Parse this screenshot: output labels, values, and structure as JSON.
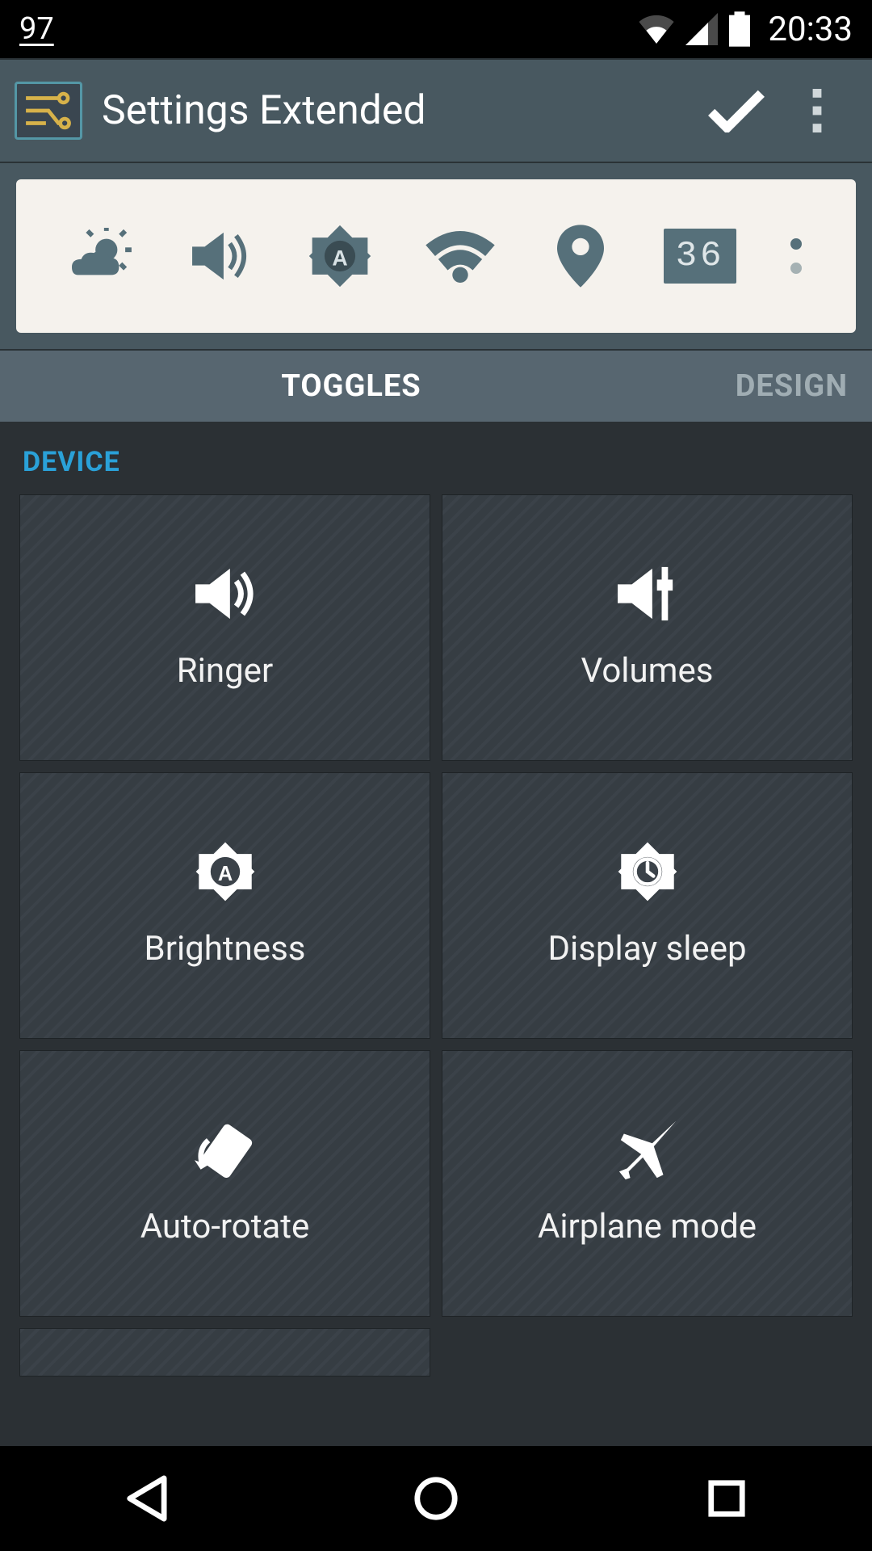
{
  "status": {
    "left": "97",
    "time": "20:33"
  },
  "appbar": {
    "title": "Settings Extended"
  },
  "preview": {
    "digit": "36"
  },
  "tabs": {
    "active": "TOGGLES",
    "inactive": "DESIGN"
  },
  "section": {
    "title": "DEVICE"
  },
  "tiles": [
    {
      "label": "Ringer"
    },
    {
      "label": "Volumes"
    },
    {
      "label": "Brightness"
    },
    {
      "label": "Display sleep"
    },
    {
      "label": "Auto-rotate"
    },
    {
      "label": "Airplane mode"
    }
  ]
}
